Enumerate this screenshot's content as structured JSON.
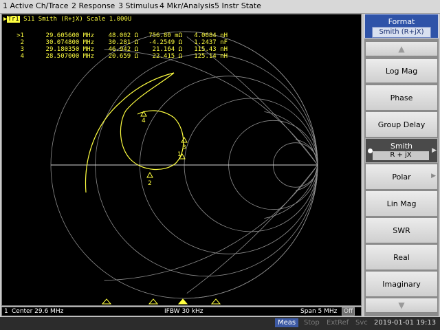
{
  "menu": [
    "1 Active Ch/Trace",
    "2 Response",
    "3 Stimulus",
    "4 Mkr/Analysis",
    "5 Instr State"
  ],
  "trace": {
    "tag": "Tr1",
    "param": "S11",
    "format": "Smith (R+jX)",
    "scale_label": "Scale",
    "scale": "1.000U"
  },
  "markers": [
    {
      "id": ">1",
      "freq": "29.605600 MHz",
      "r": "48.002 Ω",
      "x": "756.80 mΩ",
      "v": "4.0684 nH"
    },
    {
      "id": "2",
      "freq": "30.074800 MHz",
      "r": "30.281 Ω",
      "x": "-4.2549 Ω",
      "v": "1.2437 nF"
    },
    {
      "id": "3",
      "freq": "29.180350 MHz",
      "r": "46.942 Ω",
      "x": "21.164 Ω",
      "v": "115.43 nH"
    },
    {
      "id": "4",
      "freq": "28.507000 MHz",
      "r": "20.659 Ω",
      "x": "22.415 Ω",
      "v": "125.14 nH"
    }
  ],
  "marker_labels": [
    "1",
    "2",
    "3",
    "4"
  ],
  "colors": {
    "trace": "#ffff40",
    "grid": "#9a9a9a",
    "background": "#000000",
    "accent": "#2f53a8"
  },
  "status": {
    "channel": "1",
    "center": "Center 29.6 MHz",
    "ifbw": "IFBW 30 kHz",
    "span": "Span 5 MHz",
    "off": "Off"
  },
  "bottom": {
    "meas": "Meas",
    "stop": "Stop",
    "extref": "ExtRef",
    "svc": "Svc",
    "datetime": "2019-01-01 19:13"
  },
  "softkeys": {
    "title": "Format",
    "current": "Smith (R+jX)",
    "up_icon": "up-arrow-icon",
    "down_icon": "down-arrow-icon",
    "items": [
      "Log Mag",
      "Phase",
      "Group Delay",
      "Polar",
      "Lin Mag",
      "SWR",
      "Real",
      "Imaginary"
    ],
    "smith_label": "Smith",
    "smith_sub": "R + jX"
  }
}
